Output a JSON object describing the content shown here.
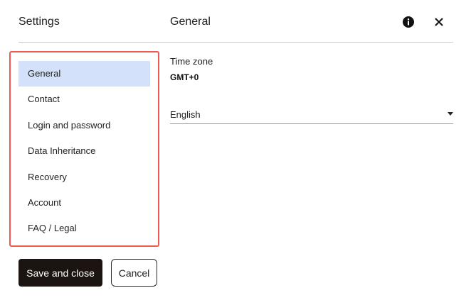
{
  "header": {
    "settings_title": "Settings",
    "section_title": "General",
    "info_icon": "info-icon",
    "close_icon": "close-icon"
  },
  "sidebar": {
    "items": [
      {
        "label": "General",
        "active": true
      },
      {
        "label": "Contact",
        "active": false
      },
      {
        "label": "Login and password",
        "active": false
      },
      {
        "label": "Data Inheritance",
        "active": false
      },
      {
        "label": "Recovery",
        "active": false
      },
      {
        "label": "Account",
        "active": false
      },
      {
        "label": "FAQ / Legal",
        "active": false
      }
    ]
  },
  "general": {
    "timezone_label": "Time zone",
    "timezone_value": "GMT+0",
    "language_value": "English",
    "dropdown_icon": "caret-down-icon"
  },
  "footer": {
    "save_label": "Save and close",
    "cancel_label": "Cancel"
  },
  "colors": {
    "active_item_bg": "#d3e2fa",
    "highlight_border": "#ee5a52",
    "primary_button_bg": "#1c1410"
  }
}
